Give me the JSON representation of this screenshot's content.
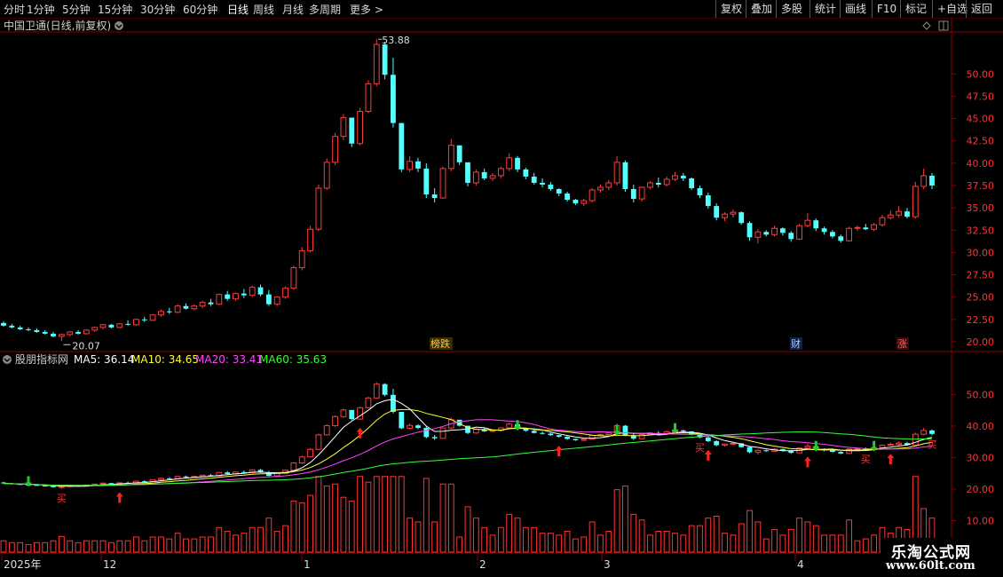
{
  "toolbar": {
    "periods": [
      "分时",
      "1分钟",
      "5分钟",
      "15分钟",
      "30分钟",
      "60分钟",
      "日线",
      "周线",
      "月线",
      "多周期",
      "更多 >"
    ],
    "active_period": "日线",
    "right_buttons": [
      "复权",
      "叠加",
      "多股",
      "统计",
      "画线",
      "F10",
      "标记",
      "+自选",
      "返回"
    ]
  },
  "price_panel": {
    "title": "中国卫通(日线,前复权)",
    "high_label": "53.88",
    "low_label": "20.07",
    "y_ticks": [
      "50.00",
      "47.50",
      "45.00",
      "42.50",
      "40.00",
      "37.50",
      "35.00",
      "32.50",
      "30.00",
      "27.50",
      "25.00",
      "22.50",
      "20.00"
    ],
    "markers": [
      {
        "text": "榜跌",
        "color": "#ffcc33",
        "bg": "#3a2a00"
      },
      {
        "text": "财",
        "color": "#aaccff",
        "bg": "#10204a"
      },
      {
        "text": "涨",
        "color": "#ff6666",
        "bg": "#3a0a0a"
      }
    ]
  },
  "indicator_panel": {
    "title": "股朋指标网",
    "ma": [
      {
        "label": "MA5: 36.14",
        "color": "#ffffff"
      },
      {
        "label": "MA10: 34.65",
        "color": "#ffff33"
      },
      {
        "label": "MA20: 33.41",
        "color": "#ff44ff"
      },
      {
        "label": "MA60: 35.63",
        "color": "#33ff33"
      }
    ],
    "y_ticks": [
      "50.00",
      "40.00",
      "30.00",
      "20.00",
      "10.00"
    ],
    "buy_label": "买"
  },
  "x_axis": {
    "labels": [
      "2025年",
      "12",
      "1",
      "2",
      "3",
      "4"
    ]
  },
  "watermark": {
    "line1": "乐淘公式网",
    "line2": "www.60lt.com"
  },
  "colors": {
    "up": "#ff3c3c",
    "down": "#54ffff",
    "ma5": "#ffffff",
    "ma10": "#ffff33",
    "ma20": "#ff44ff",
    "ma60": "#33ff33",
    "grid": "#8b0000"
  },
  "chart_data": {
    "type": "candlestick",
    "title": "中国卫通(日线,前复权)",
    "ylim": [
      19.5,
      54.5
    ],
    "candles": [
      [
        22.1,
        22.3,
        21.7,
        21.8
      ],
      [
        21.8,
        22.0,
        21.5,
        21.6
      ],
      [
        21.6,
        21.8,
        21.3,
        21.4
      ],
      [
        21.4,
        21.6,
        21.2,
        21.3
      ],
      [
        21.3,
        21.5,
        21.0,
        21.1
      ],
      [
        21.1,
        21.3,
        20.8,
        20.9
      ],
      [
        20.9,
        21.1,
        20.5,
        20.6
      ],
      [
        20.6,
        20.9,
        20.07,
        20.8
      ],
      [
        20.8,
        21.2,
        20.6,
        21.1
      ],
      [
        21.1,
        21.3,
        20.8,
        20.9
      ],
      [
        20.9,
        21.4,
        20.8,
        21.3
      ],
      [
        21.3,
        21.7,
        21.1,
        21.6
      ],
      [
        21.6,
        22.0,
        21.4,
        21.9
      ],
      [
        21.9,
        22.0,
        21.5,
        21.6
      ],
      [
        21.6,
        22.1,
        21.5,
        22.0
      ],
      [
        22.0,
        22.4,
        21.8,
        21.9
      ],
      [
        21.9,
        22.6,
        21.8,
        22.5
      ],
      [
        22.5,
        22.8,
        22.2,
        22.4
      ],
      [
        22.4,
        23.1,
        22.3,
        23.0
      ],
      [
        23.0,
        23.6,
        22.8,
        23.4
      ],
      [
        23.4,
        23.8,
        23.1,
        23.3
      ],
      [
        23.3,
        24.2,
        23.2,
        24.0
      ],
      [
        24.0,
        24.3,
        23.6,
        23.7
      ],
      [
        23.7,
        24.2,
        23.5,
        24.0
      ],
      [
        24.0,
        24.6,
        23.8,
        24.4
      ],
      [
        24.4,
        24.8,
        24.0,
        24.2
      ],
      [
        24.2,
        25.4,
        24.1,
        25.3
      ],
      [
        25.3,
        25.7,
        24.6,
        24.8
      ],
      [
        24.8,
        25.5,
        24.6,
        25.4
      ],
      [
        25.4,
        25.9,
        24.9,
        25.2
      ],
      [
        25.2,
        26.3,
        25.0,
        26.1
      ],
      [
        26.1,
        26.4,
        25.1,
        25.3
      ],
      [
        25.3,
        25.8,
        24.0,
        24.2
      ],
      [
        24.2,
        25.1,
        24.0,
        25.0
      ],
      [
        25.0,
        26.2,
        24.8,
        26.0
      ],
      [
        26.0,
        28.5,
        25.8,
        28.3
      ],
      [
        28.3,
        30.6,
        28.0,
        30.2
      ],
      [
        30.2,
        33.0,
        30.0,
        32.6
      ],
      [
        32.6,
        37.6,
        32.4,
        37.2
      ],
      [
        37.2,
        40.5,
        37.0,
        40.1
      ],
      [
        40.1,
        43.4,
        39.8,
        43.0
      ],
      [
        43.0,
        45.5,
        42.6,
        45.1
      ],
      [
        45.1,
        44.5,
        41.8,
        42.2
      ],
      [
        42.2,
        46.2,
        42.0,
        45.8
      ],
      [
        45.8,
        49.3,
        45.6,
        48.9
      ],
      [
        48.9,
        53.88,
        48.6,
        53.3
      ],
      [
        53.3,
        53.6,
        49.4,
        49.9
      ],
      [
        49.9,
        51.8,
        44.0,
        44.5
      ],
      [
        44.5,
        43.5,
        39.0,
        39.3
      ],
      [
        39.3,
        40.8,
        39.0,
        40.2
      ],
      [
        40.2,
        40.6,
        39.0,
        39.4
      ],
      [
        39.4,
        40.0,
        36.1,
        36.5
      ],
      [
        36.5,
        37.2,
        35.6,
        36.1
      ],
      [
        36.1,
        39.6,
        36.0,
        39.4
      ],
      [
        39.4,
        42.7,
        39.1,
        42.0
      ],
      [
        42.0,
        40.6,
        39.8,
        40.1
      ],
      [
        40.1,
        39.8,
        37.4,
        37.8
      ],
      [
        37.8,
        39.3,
        37.5,
        39.0
      ],
      [
        39.0,
        39.4,
        38.1,
        38.3
      ],
      [
        38.3,
        38.9,
        38.0,
        38.6
      ],
      [
        38.6,
        39.6,
        38.3,
        39.4
      ],
      [
        39.4,
        41.1,
        39.1,
        40.6
      ],
      [
        40.6,
        40.8,
        39.0,
        39.3
      ],
      [
        39.3,
        39.5,
        38.2,
        38.5
      ],
      [
        38.5,
        38.9,
        37.6,
        37.8
      ],
      [
        37.8,
        38.3,
        37.3,
        37.6
      ],
      [
        37.6,
        37.9,
        36.9,
        37.1
      ],
      [
        37.1,
        37.2,
        36.3,
        36.6
      ],
      [
        36.6,
        36.8,
        35.7,
        35.9
      ],
      [
        35.9,
        36.0,
        35.3,
        35.5
      ],
      [
        35.5,
        36.0,
        35.2,
        35.8
      ],
      [
        35.8,
        37.2,
        35.6,
        37.0
      ],
      [
        37.0,
        37.6,
        36.7,
        37.3
      ],
      [
        37.3,
        38.1,
        37.0,
        37.8
      ],
      [
        37.8,
        40.8,
        37.5,
        40.1
      ],
      [
        40.1,
        40.3,
        36.8,
        37.1
      ],
      [
        37.1,
        37.6,
        35.6,
        36.0
      ],
      [
        36.0,
        37.4,
        35.7,
        37.3
      ],
      [
        37.3,
        38.0,
        37.1,
        37.8
      ],
      [
        37.8,
        38.4,
        37.3,
        37.6
      ],
      [
        37.6,
        38.5,
        37.4,
        38.2
      ],
      [
        38.2,
        39.0,
        38.0,
        38.6
      ],
      [
        38.6,
        38.9,
        38.0,
        38.3
      ],
      [
        38.3,
        38.4,
        37.0,
        37.2
      ],
      [
        37.2,
        37.5,
        36.1,
        36.4
      ],
      [
        36.4,
        36.7,
        34.9,
        35.2
      ],
      [
        35.2,
        35.5,
        33.6,
        33.9
      ],
      [
        33.9,
        34.5,
        33.5,
        34.3
      ],
      [
        34.3,
        34.8,
        33.9,
        34.5
      ],
      [
        34.5,
        34.6,
        33.1,
        33.3
      ],
      [
        33.3,
        33.5,
        31.3,
        31.7
      ],
      [
        31.7,
        32.6,
        31.0,
        32.3
      ],
      [
        32.3,
        32.5,
        31.8,
        32.0
      ],
      [
        32.0,
        33.0,
        31.8,
        32.7
      ],
      [
        32.7,
        32.8,
        31.9,
        32.2
      ],
      [
        32.2,
        32.4,
        31.2,
        31.5
      ],
      [
        31.5,
        33.2,
        31.4,
        33.0
      ],
      [
        33.0,
        34.4,
        32.8,
        33.6
      ],
      [
        33.6,
        33.8,
        32.4,
        32.7
      ],
      [
        32.7,
        32.9,
        32.0,
        32.3
      ],
      [
        32.3,
        32.5,
        31.6,
        31.8
      ],
      [
        31.8,
        32.0,
        31.1,
        31.3
      ],
      [
        31.3,
        32.9,
        31.2,
        32.7
      ],
      [
        32.7,
        33.0,
        32.4,
        32.8
      ],
      [
        32.8,
        33.2,
        32.5,
        32.6
      ],
      [
        32.6,
        33.3,
        32.4,
        33.1
      ],
      [
        33.1,
        34.2,
        32.9,
        33.9
      ],
      [
        33.9,
        34.7,
        33.7,
        34.2
      ],
      [
        34.2,
        35.2,
        33.9,
        34.6
      ],
      [
        34.6,
        35.0,
        33.8,
        34.0
      ],
      [
        34.0,
        37.9,
        33.8,
        37.4
      ],
      [
        37.4,
        39.4,
        37.1,
        38.6
      ],
      [
        38.6,
        38.9,
        37.1,
        37.5
      ]
    ]
  }
}
